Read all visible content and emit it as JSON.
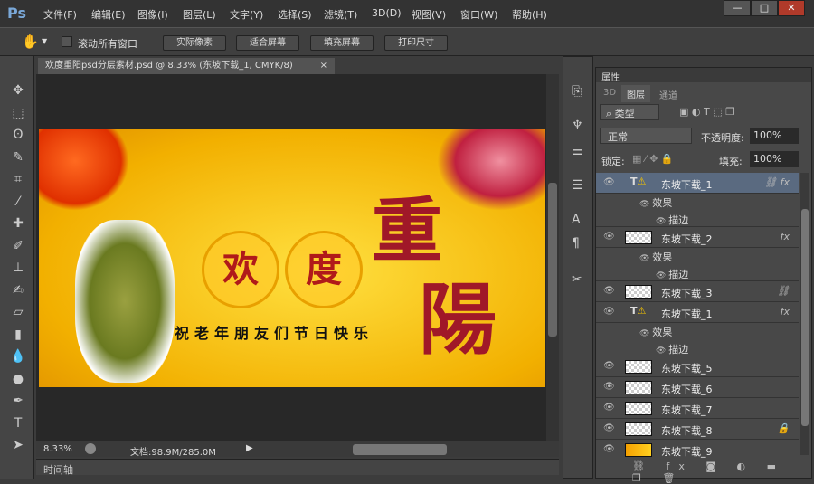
{
  "app": {
    "logo": "Ps",
    "menus": [
      "文件(F)",
      "编辑(E)",
      "图像(I)",
      "图层(L)",
      "文字(Y)",
      "选择(S)",
      "滤镜(T)",
      "3D(D)",
      "视图(V)",
      "窗口(W)",
      "帮助(H)"
    ],
    "window_controls": [
      "—",
      "□",
      "✕"
    ]
  },
  "options": {
    "scroll_all_label": "滚动所有窗口",
    "buttons": [
      "实际像素",
      "适合屏幕",
      "填充屏幕",
      "打印尺寸"
    ]
  },
  "document": {
    "tab_title": "欢度重阳psd分层素材.psd @ 8.33% (东坡下载_1, CMYK/8)",
    "close": "×",
    "banner": {
      "char1": "欢",
      "char2": "度",
      "title_top": "重",
      "title_bottom": "陽",
      "greeting": "祝老年朋友们节日快乐"
    }
  },
  "status": {
    "zoom": "8.33%",
    "doc_size": "文档:98.9M/285.0M"
  },
  "timeline": {
    "label": "时间轴"
  },
  "panel": {
    "properties_tab": "属性",
    "tabs": [
      "3D",
      "图层",
      "通道"
    ],
    "filter_kind": "类型",
    "blend_mode": "正常",
    "opacity_label": "不透明度:",
    "opacity": "100%",
    "lock_label": "锁定:",
    "fill_label": "填充:",
    "fill": "100%",
    "layers": [
      {
        "name": "东坡下载_1",
        "type": "text",
        "fx": true,
        "link": true,
        "selected": true,
        "effects": [
          "效果",
          "描边"
        ]
      },
      {
        "name": "东坡下载_2",
        "type": "image",
        "fx": true,
        "effects": [
          "效果",
          "描边"
        ]
      },
      {
        "name": "东坡下载_3",
        "type": "image",
        "link": true
      },
      {
        "name": "东坡下载_1",
        "type": "text",
        "fx": true,
        "effects": [
          "效果",
          "描边"
        ]
      },
      {
        "name": "东坡下载_5",
        "type": "image"
      },
      {
        "name": "东坡下载_6",
        "type": "image"
      },
      {
        "name": "东坡下载_7",
        "type": "image"
      },
      {
        "name": "东坡下载_8",
        "type": "image",
        "locked": true
      },
      {
        "name": "东坡下载_9",
        "type": "fill"
      }
    ]
  },
  "colors": {
    "accent": "#7aa8d8",
    "selected_row": "#5a6a80",
    "banner_red": "#b01a1a"
  }
}
